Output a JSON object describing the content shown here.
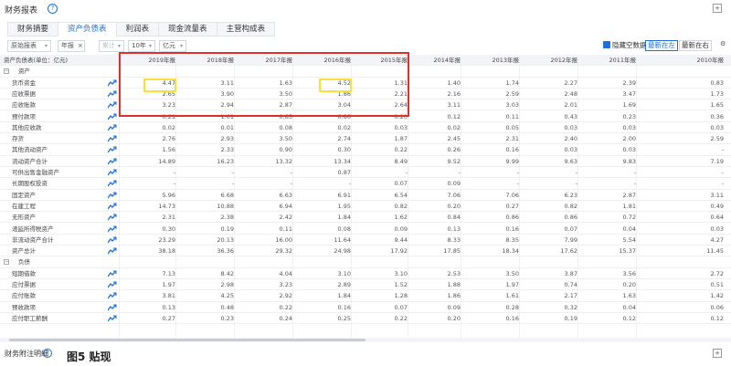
{
  "header": {
    "title": "财务报表",
    "help_icon": "?"
  },
  "tabs": [
    "财务摘要",
    "资产负债表",
    "利润表",
    "现金流量表",
    "主营构成表"
  ],
  "active_tab": 1,
  "filters": {
    "report_type": "原始报表",
    "period": "年报",
    "period_clear": "×",
    "order": "累计",
    "count": "10年",
    "unit": "亿元"
  },
  "options": {
    "hide_empty_label": "隐藏空数据",
    "latest_left": "最新在左",
    "latest_right": "最新在右"
  },
  "columns": [
    "资产负债表(单位：亿元)",
    "2019年报",
    "2018年报",
    "2017年报",
    "2016年报",
    "2015年报",
    "2014年报",
    "2013年报",
    "2012年报",
    "2011年报",
    "2010年报"
  ],
  "rows": [
    {
      "label": "资产",
      "section": true,
      "values": []
    },
    {
      "label": "货币资金",
      "values": [
        "4.47",
        "3.11",
        "1.63",
        "4.52",
        "1.31",
        "1.40",
        "1.74",
        "2.27",
        "2.39",
        "0.83"
      ]
    },
    {
      "label": "应收票据",
      "values": [
        "2.65",
        "3.90",
        "3.50",
        "1.86",
        "2.21",
        "2.16",
        "2.59",
        "2.48",
        "3.47",
        "1.73"
      ]
    },
    {
      "label": "应收账款",
      "values": [
        "3.23",
        "2.94",
        "2.87",
        "3.04",
        "2.64",
        "3.11",
        "3.03",
        "2.01",
        "1.69",
        "1.65"
      ]
    },
    {
      "label": "预付款项",
      "values": [
        "0.21",
        "1.01",
        "0.85",
        "0.86",
        "0.20",
        "0.12",
        "0.11",
        "0.43",
        "0.23",
        "0.36"
      ]
    },
    {
      "label": "其他应收款",
      "values": [
        "0.02",
        "0.01",
        "0.08",
        "0.02",
        "0.03",
        "0.02",
        "0.05",
        "0.03",
        "0.03",
        "0.03"
      ]
    },
    {
      "label": "存货",
      "values": [
        "2.76",
        "2.93",
        "3.50",
        "2.74",
        "1.87",
        "2.45",
        "2.31",
        "2.40",
        "2.00",
        "2.59"
      ]
    },
    {
      "label": "其他流动资产",
      "values": [
        "1.56",
        "2.33",
        "0.90",
        "0.30",
        "0.22",
        "0.26",
        "0.16",
        "0.03",
        "0.03",
        "-"
      ]
    },
    {
      "label": "流动资产合计",
      "values": [
        "14.89",
        "16.23",
        "13.32",
        "13.34",
        "8.49",
        "9.52",
        "9.99",
        "9.63",
        "9.83",
        "7.19"
      ]
    },
    {
      "label": "可供出售金融资产",
      "values": [
        "-",
        "-",
        "-",
        "0.87",
        "-",
        "-",
        "-",
        "-",
        "-",
        "-"
      ]
    },
    {
      "label": "长期股权投资",
      "values": [
        "-",
        "-",
        "-",
        "-",
        "0.07",
        "0.09",
        "-",
        "-",
        "-",
        "-"
      ]
    },
    {
      "label": "固定资产",
      "values": [
        "5.96",
        "6.68",
        "6.63",
        "6.91",
        "6.54",
        "7.06",
        "7.06",
        "6.23",
        "2.87",
        "3.11"
      ]
    },
    {
      "label": "在建工程",
      "values": [
        "14.73",
        "10.88",
        "6.94",
        "1.95",
        "0.82",
        "0.20",
        "0.27",
        "0.82",
        "1.81",
        "0.49"
      ]
    },
    {
      "label": "无形资产",
      "values": [
        "2.31",
        "2.38",
        "2.42",
        "1.84",
        "1.62",
        "0.84",
        "0.86",
        "0.86",
        "0.72",
        "0.64"
      ]
    },
    {
      "label": "递延所得税资产",
      "values": [
        "0.30",
        "0.19",
        "0.11",
        "0.08",
        "0.09",
        "0.13",
        "0.16",
        "0.07",
        "0.04",
        "0.03"
      ]
    },
    {
      "label": "非流动资产合计",
      "values": [
        "23.29",
        "20.13",
        "16.00",
        "11.64",
        "9.44",
        "8.33",
        "8.35",
        "7.99",
        "5.54",
        "4.27"
      ]
    },
    {
      "label": "资产总计",
      "values": [
        "38.18",
        "36.36",
        "29.32",
        "24.98",
        "17.92",
        "17.85",
        "18.34",
        "17.62",
        "15.37",
        "11.45"
      ]
    },
    {
      "label": "负债",
      "section": true,
      "values": []
    },
    {
      "label": "短期借款",
      "values": [
        "7.13",
        "8.42",
        "4.04",
        "3.10",
        "3.10",
        "2.53",
        "3.50",
        "3.87",
        "3.56",
        "2.72"
      ]
    },
    {
      "label": "应付票据",
      "values": [
        "1.97",
        "2.98",
        "3.23",
        "2.89",
        "1.52",
        "1.88",
        "1.97",
        "0.74",
        "0.20",
        "0.51"
      ]
    },
    {
      "label": "应付账款",
      "values": [
        "3.81",
        "4.25",
        "2.92",
        "1.84",
        "1.28",
        "1.86",
        "1.61",
        "2.17",
        "1.63",
        "1.42"
      ]
    },
    {
      "label": "预收款项",
      "values": [
        "0.13",
        "0.48",
        "0.22",
        "0.16",
        "0.07",
        "0.09",
        "0.28",
        "0.32",
        "0.04",
        "0.06"
      ]
    },
    {
      "label": "应付职工薪酬",
      "values": [
        "0.27",
        "0.23",
        "0.24",
        "0.25",
        "0.22",
        "0.20",
        "0.16",
        "0.19",
        "0.12",
        "0.12"
      ]
    }
  ],
  "bottom": {
    "title": "财务附注明细",
    "caption": "图5 贴现"
  },
  "colors": {
    "accent": "#1e6fd8",
    "highlight_red": "#e0302b",
    "highlight_yellow": "#f6e23a"
  }
}
